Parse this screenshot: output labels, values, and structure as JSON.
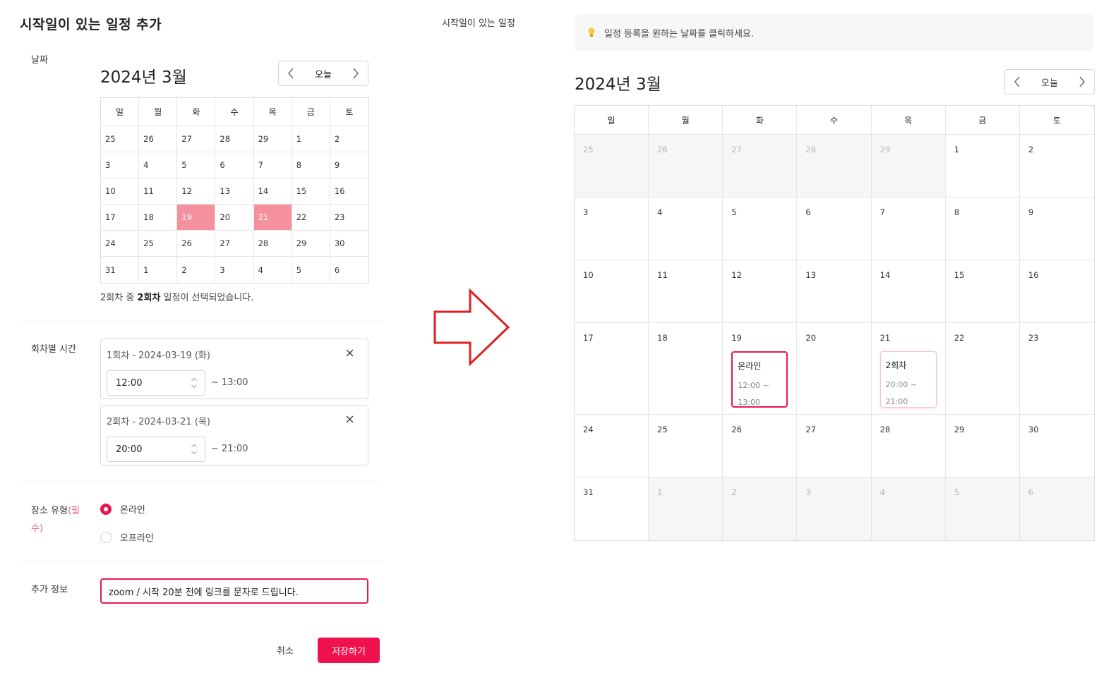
{
  "left": {
    "title": "시작일이 있는 일정 추가",
    "labels": {
      "date": "날짜",
      "session_time": "회차별 시간",
      "place_type": "장소 유형",
      "required_suffix": "(필수)",
      "extra_info": "추가 정보"
    },
    "mini_calendar": {
      "month_title": "2024년 3월",
      "today_label": "오늘",
      "weekdays": [
        "일",
        "월",
        "화",
        "수",
        "목",
        "금",
        "토"
      ],
      "weeks": [
        [
          "25",
          "26",
          "27",
          "28",
          "29",
          "1",
          "2"
        ],
        [
          "3",
          "4",
          "5",
          "6",
          "7",
          "8",
          "9"
        ],
        [
          "10",
          "11",
          "12",
          "13",
          "14",
          "15",
          "16"
        ],
        [
          "17",
          "18",
          "19",
          "20",
          "21",
          "22",
          "23"
        ],
        [
          "24",
          "25",
          "26",
          "27",
          "28",
          "29",
          "30"
        ],
        [
          "31",
          "1",
          "2",
          "3",
          "4",
          "5",
          "6"
        ]
      ],
      "selected": [
        "19",
        "21"
      ]
    },
    "selection_text": {
      "pre": "2회차 중 ",
      "bold": "2회차",
      "post": " 일정이 선택되었습니다."
    },
    "sessions": [
      {
        "title": "1회차 - 2024-03-19 (화)",
        "start": "12:00",
        "end": "~ 13:00"
      },
      {
        "title": "2회차 - 2024-03-21 (목)",
        "start": "20:00",
        "end": "~ 21:00"
      }
    ],
    "place_options": [
      {
        "label": "온라인",
        "selected": true
      },
      {
        "label": "오프라인",
        "selected": false
      }
    ],
    "extra_info_value": "zoom / 시작 20분 전에 링크를 문자로 드립니다.",
    "cancel_label": "취소",
    "save_label": "저장하기"
  },
  "caption": "시작일이 있는 일정",
  "right": {
    "hint": "일정 등록을 원하는 날짜를 클릭하세요.",
    "month_title": "2024년 3월",
    "today_label": "오늘",
    "weekdays": [
      "일",
      "월",
      "화",
      "수",
      "목",
      "금",
      "토"
    ],
    "weeks": [
      [
        "25",
        "26",
        "27",
        "28",
        "29",
        "1",
        "2"
      ],
      [
        "3",
        "4",
        "5",
        "6",
        "7",
        "8",
        "9"
      ],
      [
        "10",
        "11",
        "12",
        "13",
        "14",
        "15",
        "16"
      ],
      [
        "17",
        "18",
        "19",
        "20",
        "21",
        "22",
        "23"
      ],
      [
        "24",
        "25",
        "26",
        "27",
        "28",
        "29",
        "30"
      ],
      [
        "31",
        "1",
        "2",
        "3",
        "4",
        "5",
        "6"
      ]
    ],
    "events": [
      {
        "title": "온라인",
        "time_start": "12:00 ~",
        "time_end": "13:00"
      },
      {
        "title": "2회차",
        "time_start": "20:00 ~",
        "time_end": "21:00"
      }
    ]
  },
  "colors": {
    "accent": "#e8194f",
    "selected_day": "#f5909e",
    "save_button": "#f0124e",
    "arrow": "#e02020"
  }
}
